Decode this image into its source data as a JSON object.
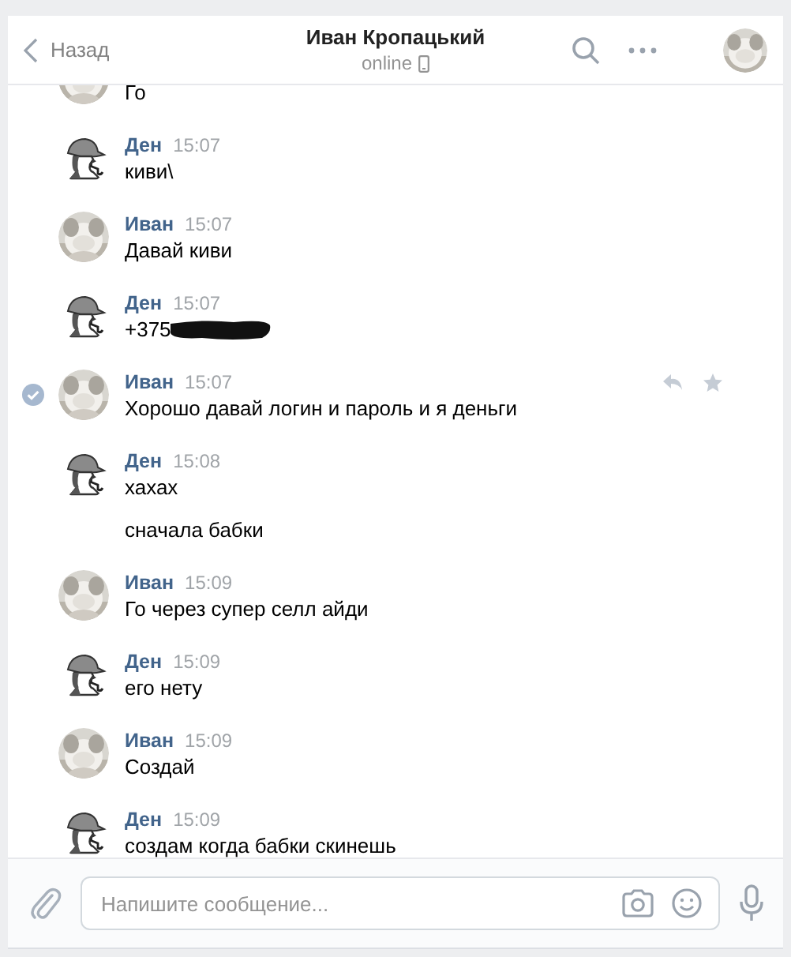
{
  "header": {
    "back": "Назад",
    "title": "Иван Кропацький",
    "status": "online"
  },
  "messages": [
    {
      "selected": false,
      "lines": [
        {
          "kind": "text",
          "text": "Го"
        }
      ]
    },
    {
      "kind": "drawing",
      "author": "Ден",
      "time": "15:07",
      "selected": false,
      "lines": [
        {
          "kind": "text",
          "text": "киви\\"
        }
      ]
    },
    {
      "author": "Иван",
      "time": "15:07",
      "selected": false,
      "lines": [
        {
          "kind": "text",
          "text": "Давай киви"
        }
      ]
    },
    {
      "kind": "drawing",
      "author": "Ден",
      "time": "15:07",
      "selected": false,
      "lines": [
        {
          "kind": "scribbled",
          "text": "+375"
        }
      ]
    },
    {
      "author": "Иван",
      "time": "15:07",
      "selected": true,
      "lines": [
        {
          "kind": "text",
          "text": "Хорошо давай логин и пароль и я деньги"
        }
      ]
    },
    {
      "kind": "drawing",
      "author": "Ден",
      "time": "15:08",
      "selected": false,
      "lines": [
        {
          "kind": "text",
          "text": "хахах"
        },
        {
          "kind": "text",
          "text": "сначала бабки"
        }
      ]
    },
    {
      "author": "Иван",
      "time": "15:09",
      "selected": false,
      "lines": [
        {
          "kind": "text",
          "text": "Го через супер селл айди"
        }
      ]
    },
    {
      "kind": "drawing",
      "author": "Ден",
      "time": "15:09",
      "selected": false,
      "lines": [
        {
          "kind": "text",
          "text": "его нету"
        }
      ]
    },
    {
      "author": "Иван",
      "time": "15:09",
      "selected": false,
      "lines": [
        {
          "kind": "text",
          "text": "Создай"
        }
      ]
    },
    {
      "kind": "drawing",
      "author": "Ден",
      "time": "15:09",
      "selected": false,
      "lines": [
        {
          "kind": "text",
          "text": "создам когда бабки скинешь"
        }
      ]
    }
  ],
  "composer": {
    "placeholder": "Напишите сообщение..."
  }
}
